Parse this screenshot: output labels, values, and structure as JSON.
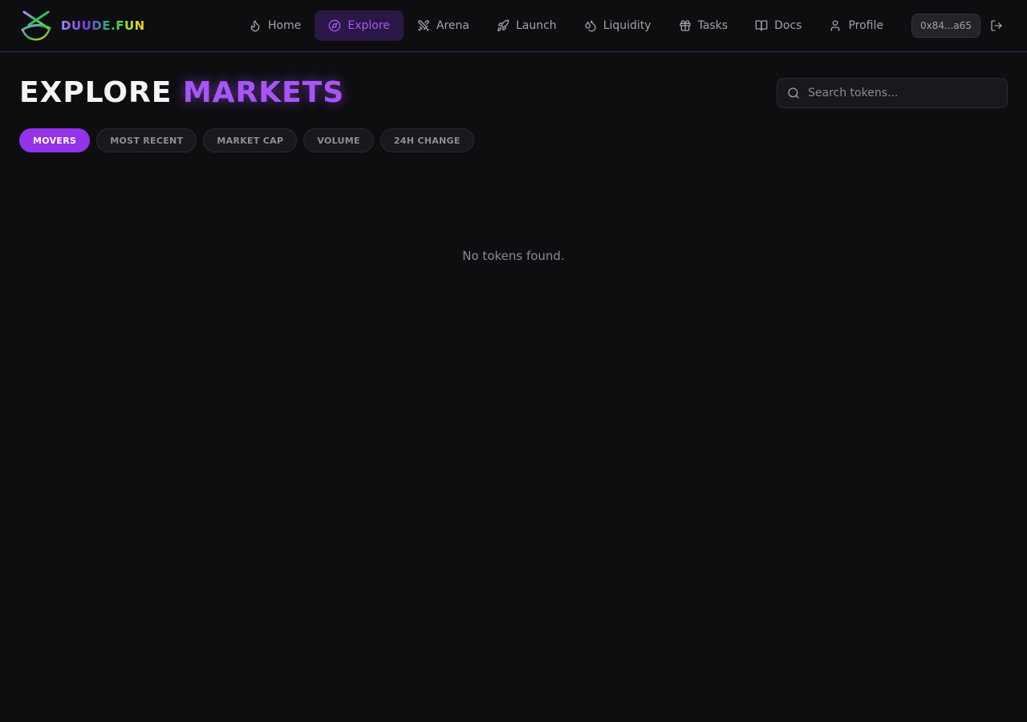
{
  "header": {
    "logo_text": "DUUDE.FUN",
    "nav": [
      {
        "label": "Home",
        "icon": "flame-icon",
        "active": false
      },
      {
        "label": "Explore",
        "icon": "compass-icon",
        "active": true
      },
      {
        "label": "Arena",
        "icon": "swords-icon",
        "active": false
      },
      {
        "label": "Launch",
        "icon": "rocket-icon",
        "active": false
      },
      {
        "label": "Liquidity",
        "icon": "droplets-icon",
        "active": false
      },
      {
        "label": "Tasks",
        "icon": "gift-icon",
        "active": false
      },
      {
        "label": "Docs",
        "icon": "book-open-icon",
        "active": false
      },
      {
        "label": "Profile",
        "icon": "user-icon",
        "active": false
      }
    ],
    "wallet": "0x84...a65",
    "logout_icon": "log-out-icon"
  },
  "main": {
    "title_part1": "EXPLORE",
    "title_part2": "MARKETS",
    "search": {
      "placeholder": "Search tokens...",
      "value": ""
    },
    "tabs": [
      {
        "label": "MOVERS",
        "active": true
      },
      {
        "label": "MOST RECENT",
        "active": false
      },
      {
        "label": "MARKET CAP",
        "active": false
      },
      {
        "label": "VOLUME",
        "active": false
      },
      {
        "label": "24H CHANGE",
        "active": false
      }
    ],
    "empty_message": "No tokens found."
  },
  "colors": {
    "background": "#0e0e11",
    "accent": "#a855f7",
    "accent_strong": "#9333ea",
    "header_border": "#3b2466",
    "muted_text": "#a1a1aa"
  }
}
